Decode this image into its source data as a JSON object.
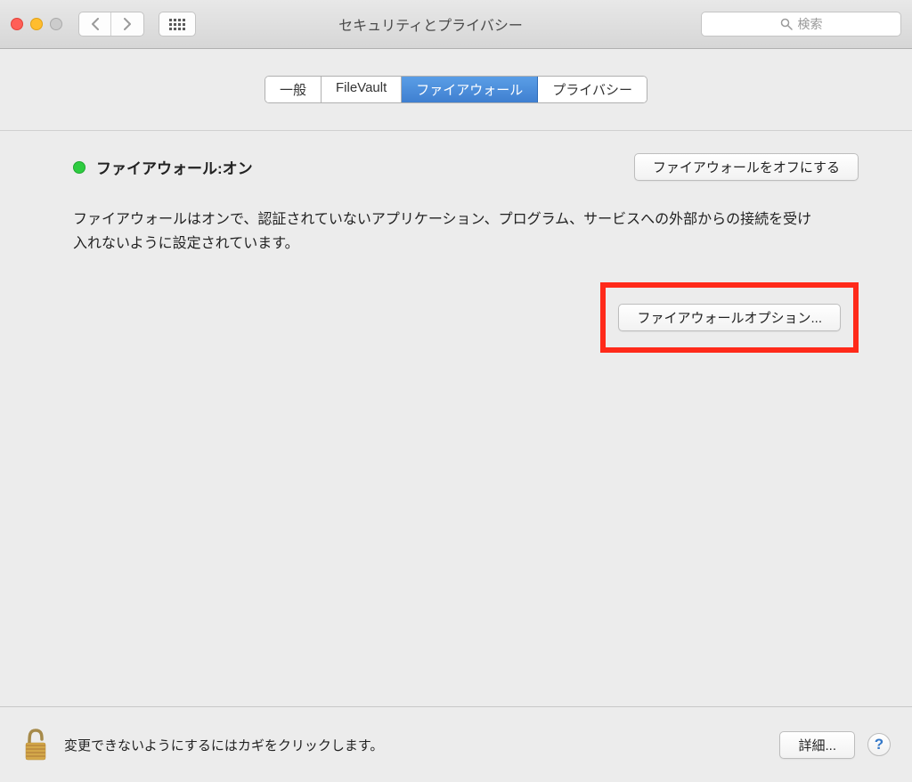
{
  "window": {
    "title": "セキュリティとプライバシー",
    "search_placeholder": "検索"
  },
  "tabs": [
    {
      "label": "一般",
      "active": false
    },
    {
      "label": "FileVault",
      "active": false
    },
    {
      "label": "ファイアウォール",
      "active": true
    },
    {
      "label": "プライバシー",
      "active": false
    }
  ],
  "firewall": {
    "status_label": "ファイアウォール:オン",
    "status_color": "#2ecc40",
    "turn_off_button": "ファイアウォールをオフにする",
    "description": "ファイアウォールはオンで、認証されていないアプリケーション、プログラム、サービスへの外部からの接続を受け入れないように設定されています。",
    "options_button": "ファイアウォールオプション..."
  },
  "footer": {
    "lock_text": "変更できないようにするにはカギをクリックします。",
    "advanced_button": "詳細...",
    "help_label": "?"
  }
}
